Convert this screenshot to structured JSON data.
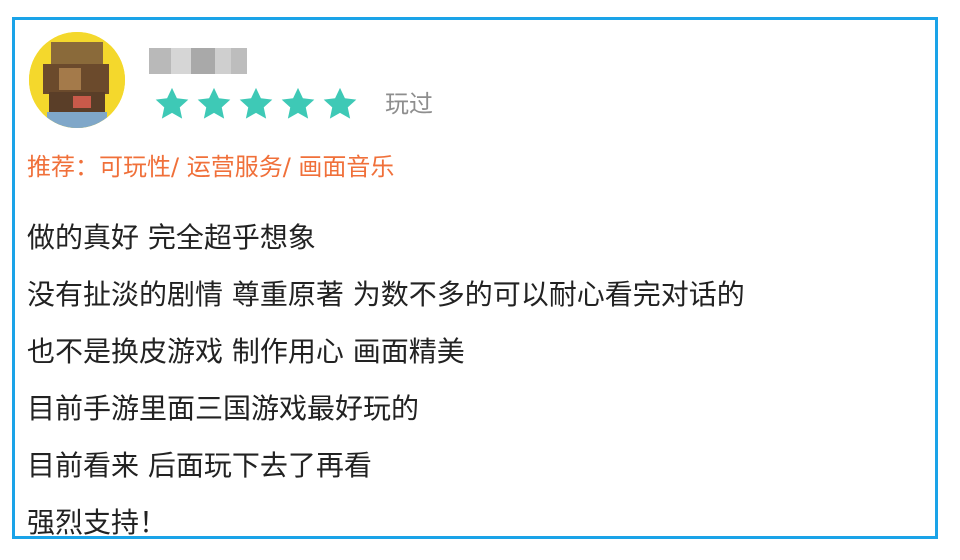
{
  "review": {
    "username": "",
    "rating": 5,
    "rating_max": 5,
    "status": "玩过",
    "recommend": "推荐：可玩性/ 运营服务/ 画面音乐",
    "lines": [
      "做的真好 完全超乎想象",
      "没有扯淡的剧情 尊重原著 为数不多的可以耐心看完对话的",
      "也不是换皮游戏 制作用心 画面精美",
      "目前手游里面三国游戏最好玩的",
      "目前看来 后面玩下去了再看",
      "强烈支持！"
    ]
  },
  "colors": {
    "border": "#1aa3e8",
    "star": "#3ec9b6",
    "recommend": "#f0703a",
    "status": "#8e8e8e",
    "text": "#222222"
  },
  "icons": {
    "star": "star-icon"
  }
}
